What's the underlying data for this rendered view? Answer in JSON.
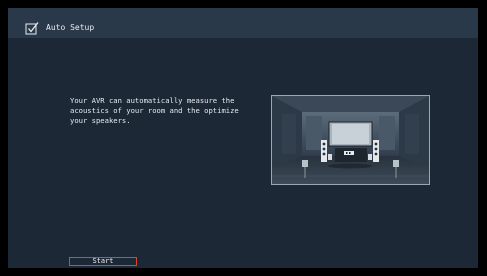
{
  "header": {
    "icon": "checkbox-check-icon",
    "title": "Auto Setup"
  },
  "main": {
    "description_lines": [
      "Your AVR can automatically measure the",
      "acoustics of your room and the optimize",
      "your speakers."
    ],
    "illustration": "home-theater-room-illustration"
  },
  "footer": {
    "start_label": "Start"
  },
  "colors": {
    "background": "#1c2836",
    "header": "#2a3949",
    "text": "#e6ebf0",
    "focus_border": "#d64a2a"
  }
}
